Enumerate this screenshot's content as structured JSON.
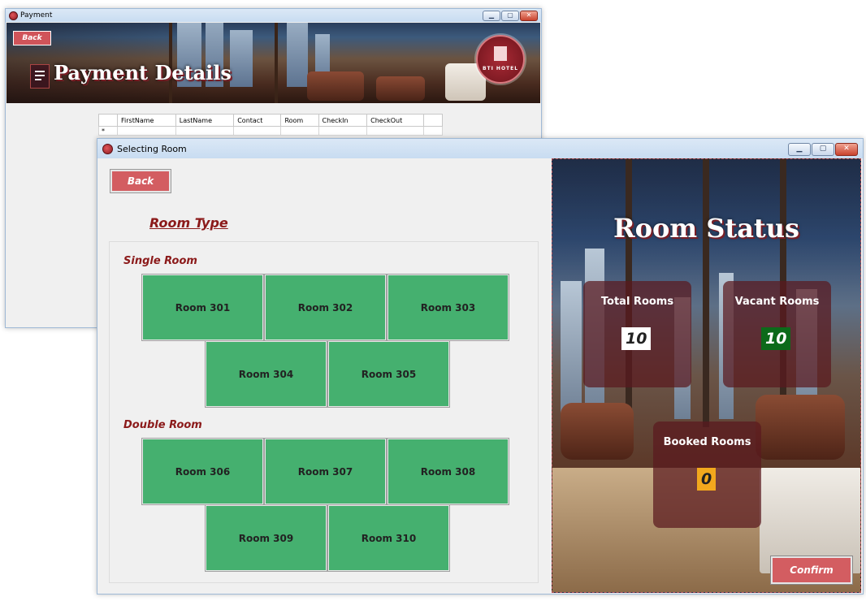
{
  "payment_window": {
    "title": "Payment",
    "back_label": "Back",
    "heading": "Payment Details",
    "logo_text": "BTI HOTEL",
    "table_columns": [
      "FirstName",
      "LastName",
      "Contact",
      "Room",
      "CheckIn",
      "CheckOut"
    ],
    "new_row_marker": "*"
  },
  "select_window": {
    "title": "Selecting Room",
    "back_label": "Back",
    "room_type_heading": "Room Type",
    "single_label": "Single Room",
    "double_label": "Double Room",
    "single_rooms": [
      "Room 301",
      "Room 302",
      "Room 303",
      "Room 304",
      "Room 305"
    ],
    "double_rooms": [
      "Room 306",
      "Room 307",
      "Room 308",
      "Room 309",
      "Room 310"
    ],
    "status": {
      "title": "Room Status",
      "total_label": "Total Rooms",
      "total_value": "10",
      "vacant_label": "Vacant Rooms",
      "vacant_value": "10",
      "booked_label": "Booked Rooms",
      "booked_value": "0"
    },
    "confirm_label": "Confirm"
  },
  "colors": {
    "room_button": "#45b06f",
    "accent_button": "#d35d61",
    "heading_red": "#8b1a1a",
    "vacant_badge": "#0c6a1a",
    "booked_badge": "#f2a81d"
  }
}
